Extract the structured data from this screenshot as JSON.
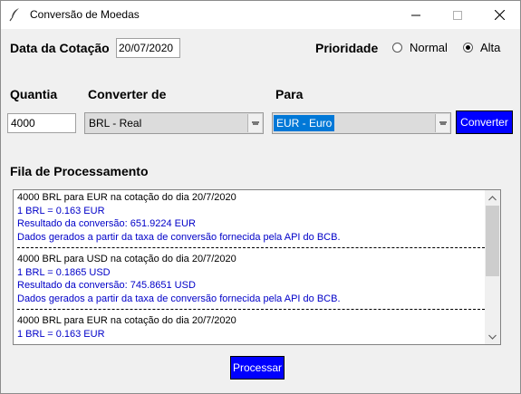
{
  "window": {
    "title": "Conversão de Moedas"
  },
  "header": {
    "date_label": "Data da Cotação",
    "date_value": "20/07/2020",
    "priority_label": "Prioridade",
    "priority_options": [
      {
        "label": "Normal",
        "selected": false
      },
      {
        "label": "Alta",
        "selected": true
      }
    ]
  },
  "form": {
    "quantity_label": "Quantia",
    "from_label": "Converter de",
    "to_label": "Para",
    "quantity_value": "4000",
    "from_value": "BRL - Real",
    "to_value": "EUR - Euro",
    "convert_button": "Converter"
  },
  "queue": {
    "label": "Fila de Processamento",
    "entries": [
      {
        "title": "4000 BRL para EUR na cotação do dia 20/7/2020",
        "rate": "1 BRL = 0.163 EUR",
        "result": "Resultado da conversão: 651.9224 EUR",
        "source": "Dados gerados a partir da taxa de conversão fornecida pela API do BCB."
      },
      {
        "title": "4000 BRL para USD na cotação do dia 20/7/2020",
        "rate": "1 BRL = 0.1865 USD",
        "result": "Resultado da conversão: 745.8651 USD",
        "source": "Dados gerados a partir da taxa de conversão fornecida pela API do BCB."
      },
      {
        "title": "4000 BRL para EUR na cotação do dia 20/7/2020",
        "rate": "1 BRL = 0.163 EUR"
      }
    ]
  },
  "footer": {
    "process_button": "Processar"
  },
  "colors": {
    "accent_button": "#0000ff",
    "selection": "#0078d7",
    "log_blue": "#0000c8"
  },
  "icons": [
    "feather-app-icon",
    "minimize-icon",
    "maximize-icon",
    "close-icon",
    "dropdown-arrow-icon",
    "scroll-up-icon",
    "scroll-down-icon"
  ]
}
